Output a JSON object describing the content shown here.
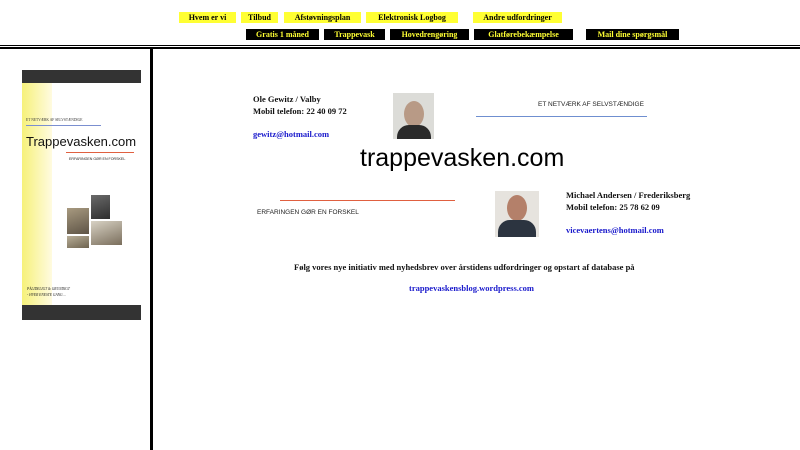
{
  "nav": {
    "row1": [
      "Hvem er vi",
      "Tilbud",
      "Afstøvningsplan",
      "Elektronisk Logbog",
      "Andre udfordringer"
    ],
    "row2": [
      "Gratis 1 måned",
      "Trappevask",
      "Hovedrengøring",
      "Glatførebekæmpelse",
      "Mail dine spørgsmål"
    ]
  },
  "sidebar": {
    "tagline": "ET NETVÆRK AF SELVSTÆNDIGE",
    "brand": "Trappevasken.com",
    "sub": "ERFARINGEN GØR EN FORSKEL",
    "footer1": "PÅLIDELIGT & GRUNDIGT",
    "footer2": "- HVER ENESTE GANG ..."
  },
  "contact1": {
    "name": "Ole Gewitz / Valby",
    "phone": "Mobil telefon: 22 40 09 72",
    "email": "gewitz@hotmail.com"
  },
  "contact2": {
    "name": "Michael Andersen / Frederiksberg",
    "phone": "Mobil telefon: 25 78 62 09",
    "email": "vicevaertens@hotmail.com"
  },
  "main": {
    "network": "ET NETVÆRK AF SELVSTÆNDIGE",
    "title": "trappevasken.com",
    "experience": "ERFARINGEN GØR EN FORSKEL",
    "newsletter": "Følg vores nye initiativ med nyhedsbrev over årstidens udfordringer og opstart af database på",
    "blog_link": "trappevaskensblog.wordpress.com"
  },
  "colors": {
    "nav_yellow": "#ffff33",
    "nav_black": "#000000",
    "link": "#1a1acc",
    "blue_rule": "#6f8fd0",
    "red_rule": "#e06040"
  }
}
